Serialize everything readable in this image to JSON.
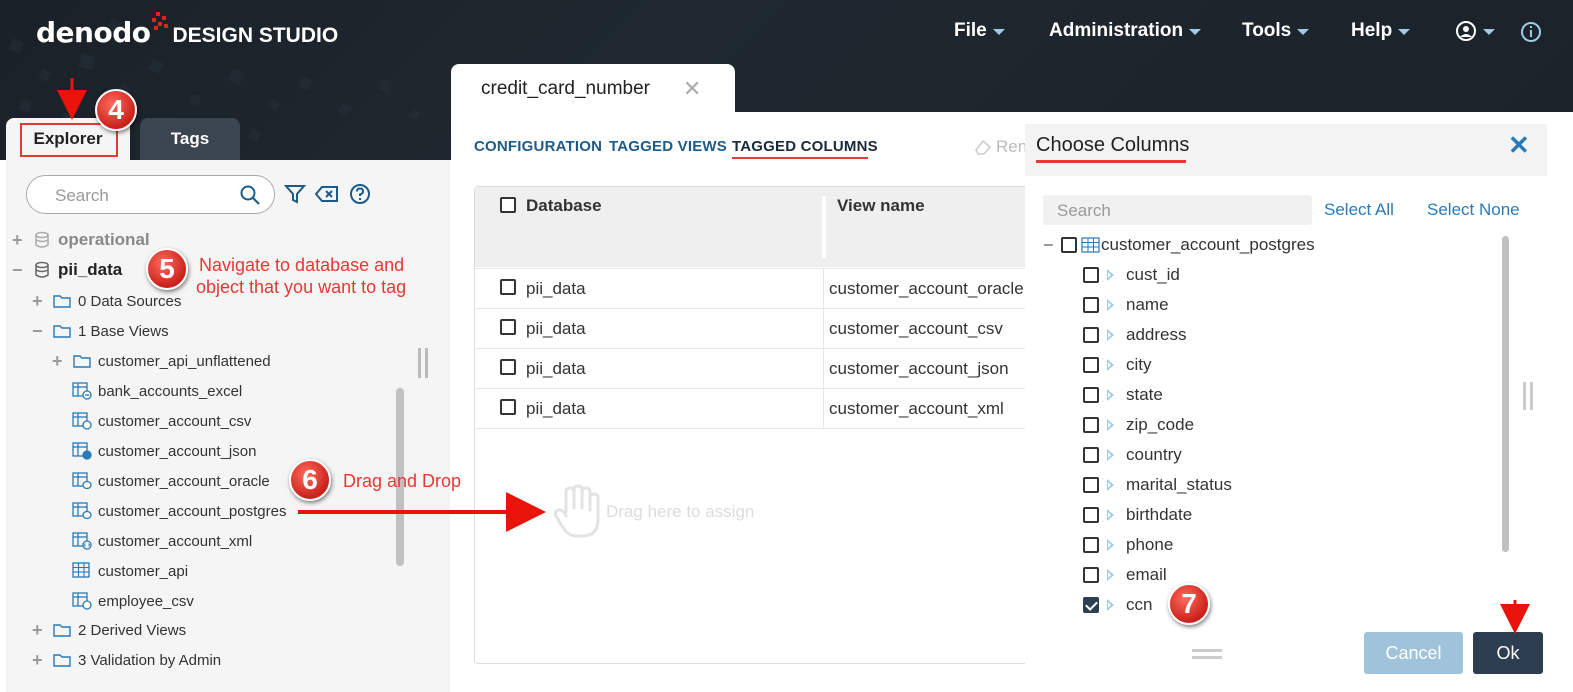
{
  "app": {
    "brand": "denodo",
    "studio": "DESIGN STUDIO"
  },
  "topmenu": [
    {
      "label": "File"
    },
    {
      "label": "Administration"
    },
    {
      "label": "Tools"
    },
    {
      "label": "Help"
    }
  ],
  "left": {
    "tabs": {
      "explorer": "Explorer",
      "tags": "Tags"
    },
    "search_placeholder": "Search",
    "tree": {
      "operational": "operational",
      "pii_data": "pii_data",
      "data_sources": "0 Data Sources",
      "base_views": "1 Base Views",
      "items": [
        "customer_api_unflattened",
        "bank_accounts_excel",
        "customer_account_csv",
        "customer_account_json",
        "customer_account_oracle",
        "customer_account_postgres",
        "customer_account_xml",
        "customer_api",
        "employee_csv"
      ],
      "derived_views": "2 Derived Views",
      "validation": "3 Validation by Admin"
    }
  },
  "center": {
    "tab_title": "credit_card_number",
    "subtabs": [
      "CONFIGURATION",
      "TAGGED VIEWS",
      "TAGGED COLUMNS"
    ],
    "rename_partial": "Ren",
    "table": {
      "headers": [
        "Database",
        "View name"
      ],
      "rows": [
        {
          "database": "pii_data",
          "view": "customer_account_oracle"
        },
        {
          "database": "pii_data",
          "view": "customer_account_csv"
        },
        {
          "database": "pii_data",
          "view": "customer_account_json"
        },
        {
          "database": "pii_data",
          "view": "customer_account_xml"
        }
      ]
    },
    "drag_hint": "Drag here to assign"
  },
  "dialog": {
    "title": "Choose Columns",
    "search_placeholder": "Search",
    "select_all": "Select All",
    "select_none": "Select None",
    "view_name": "customer_account_postgres",
    "columns": [
      {
        "name": "cust_id",
        "checked": false
      },
      {
        "name": "name",
        "checked": false
      },
      {
        "name": "address",
        "checked": false
      },
      {
        "name": "city",
        "checked": false
      },
      {
        "name": "state",
        "checked": false
      },
      {
        "name": "zip_code",
        "checked": false
      },
      {
        "name": "country",
        "checked": false
      },
      {
        "name": "marital_status",
        "checked": false
      },
      {
        "name": "birthdate",
        "checked": false
      },
      {
        "name": "phone",
        "checked": false
      },
      {
        "name": "email",
        "checked": false
      },
      {
        "name": "ccn",
        "checked": true
      }
    ],
    "cancel": "Cancel",
    "ok": "Ok"
  },
  "annotations": {
    "step4": "4",
    "step5": "5",
    "step5_text_line1": "Navigate to database and",
    "step5_text_line2": "object that you want to tag",
    "step6": "6",
    "step6_text": "Drag and Drop",
    "step7": "7"
  },
  "colors": {
    "header_bg": "#1b2229",
    "accent_red": "#e53935",
    "link_blue": "#2a7ab8",
    "ok_button": "#2c3e50",
    "cancel_button": "#9fc3db"
  }
}
